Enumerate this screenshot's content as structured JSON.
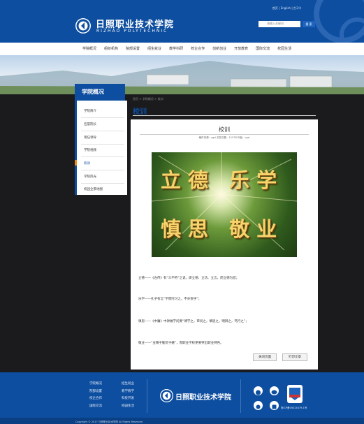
{
  "header": {
    "toplinks": "首页 | English | 한국어",
    "school_cn": "日照职业技术学院",
    "school_en": "RIZHAO POLYTECHNIC",
    "search_placeholder": "请输入关键词",
    "search_button": "搜 索"
  },
  "nav": [
    "学院概况",
    "组织机构",
    "院部设置",
    "招生就业",
    "教学科研",
    "校企合作",
    "创新创业",
    "开放教育",
    "国际交流",
    "校园生活"
  ],
  "sidebar": {
    "title": "学院概况",
    "items": [
      "学院简介",
      "名誉院长",
      "现任领导",
      "学院视频",
      "校训",
      "学院风光",
      "校园全景地图"
    ],
    "active_index": 4
  },
  "main": {
    "breadcrumb": "首页 > 学院概况 > 校训",
    "title": "校训"
  },
  "article": {
    "title": "校训",
    "meta": "稿件来源：cgzl  浏览次数：11578  作者：cgzl",
    "image_line1": "立德 乐学",
    "image_line2": "慎思 敬业",
    "paragraphs": [
      "立德——《左传》有“三不朽”之说，即立德、立功、立言，而立德为首；",
      "乐学——孔子有言“学而时习之，不亦悦乎”；",
      "慎思——《中庸》中讲做学问要“博学之，审问之，慎思之，明辨之，笃行之”；",
      "敬业——“业精于勤荒于嬉”，而职业学校更要突出职业特色。"
    ],
    "close_button": "关闭页面",
    "print_button": "打印文章"
  },
  "footer": {
    "col1": [
      "学院概况",
      "院部设置",
      "校企合作",
      "国际交流"
    ],
    "col2": [
      "招生就业",
      "教学教学",
      "科技开发",
      "校园生活"
    ],
    "name": "日照职业技术学院",
    "badge_text": "鲁ICP备05024479-1号"
  },
  "bottom_bar": "Copyright © 2017 日照职业技术学院 All Rights Reserved"
}
